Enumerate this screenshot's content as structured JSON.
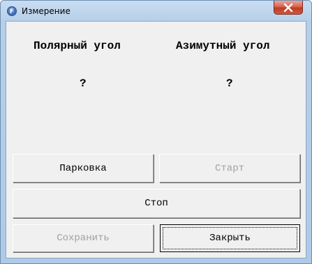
{
  "window": {
    "title": "Измерение",
    "app_icon_letter": "F"
  },
  "measurements": {
    "polar": {
      "label": "Полярный угол",
      "value": "?"
    },
    "azimuth": {
      "label": "Азимутный угол",
      "value": "?"
    }
  },
  "buttons": {
    "park": {
      "label": "Парковка",
      "enabled": true
    },
    "start": {
      "label": "Старт",
      "enabled": false
    },
    "stop": {
      "label": "Стоп",
      "enabled": true
    },
    "save": {
      "label": "Сохранить",
      "enabled": false
    },
    "close": {
      "label": "Закрыть",
      "enabled": true
    }
  },
  "colors": {
    "disabled_text": "#a0a0a0",
    "face": "#f0f0f0"
  }
}
